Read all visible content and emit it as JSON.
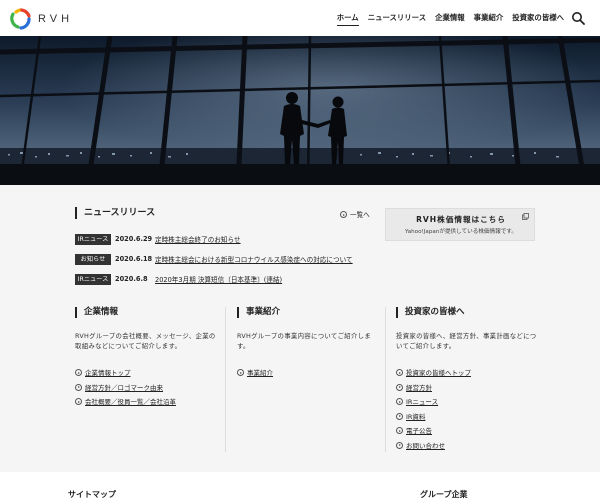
{
  "header": {
    "logo_text": "RVH",
    "nav": [
      "ホーム",
      "ニュースリリース",
      "企業情報",
      "事業紹介",
      "投資家の皆様へ"
    ]
  },
  "news": {
    "title": "ニュースリリース",
    "more": "一覧へ",
    "items": [
      {
        "badge": "IRニュース",
        "date": "2020.6.29",
        "text": "定時株主総会終了のお知らせ"
      },
      {
        "badge": "お知らせ",
        "date": "2020.6.18",
        "text": "定時株主総会における新型コロナウイルス感染症への対応について"
      },
      {
        "badge": "IRニュース",
        "date": "2020.6.8",
        "text": "2020年3月期 決算短信〔日本基準〕(連結)"
      }
    ]
  },
  "stock": {
    "title": "RVH株価情報はこちら",
    "sub": "Yahoo!Japanが提供している株価情報です。"
  },
  "columns": [
    {
      "title": "企業情報",
      "desc": "RVHグループの会社概要、メッセージ、企業の取組みなどについてご紹介します。",
      "links": [
        "企業情報トップ",
        "経営方針／ロゴマーク由来",
        "会社概要／役員一覧／会社沿革"
      ]
    },
    {
      "title": "事業紹介",
      "desc": "RVHグループの事業内容についてご紹介します。",
      "links": [
        "事業紹介"
      ]
    },
    {
      "title": "投資家の皆様へ",
      "desc": "投資家の皆様へ、経営方針、事業計画などについてご紹介します。",
      "links": [
        "投資家の皆様へトップ",
        "経営方針",
        "IRニュース",
        "IR資料",
        "電子公告",
        "お問い合わせ"
      ]
    }
  ],
  "footer": {
    "left": "サイトマップ",
    "right": "グループ企業"
  },
  "colors": {
    "logo_red": "#e8412c",
    "logo_green": "#3cb44a",
    "logo_blue": "#2a6fd6",
    "badge_bg": "#333333",
    "content_bg": "#f5f5f5"
  }
}
